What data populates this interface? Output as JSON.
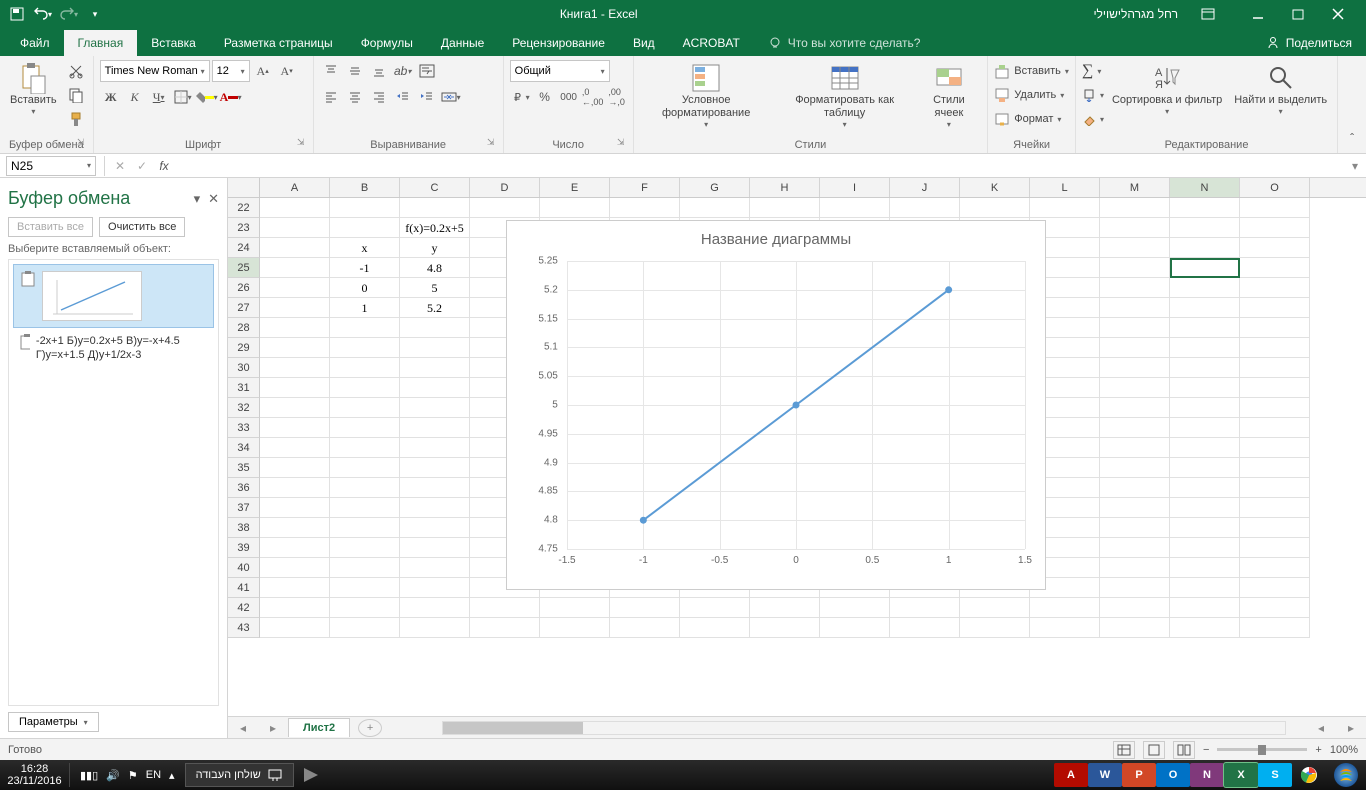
{
  "title": "Книга1  -  Excel",
  "user": "רחל מגרהלישוילי",
  "tabs": {
    "file": "Файл",
    "home": "Главная",
    "insert": "Вставка",
    "layout": "Разметка страницы",
    "formulas": "Формулы",
    "data": "Данные",
    "review": "Рецензирование",
    "view": "Вид",
    "acrobat": "ACROBAT",
    "tell": "Что вы хотите сделать?",
    "share": "Поделиться"
  },
  "ribbon": {
    "clipboard": {
      "label": "Буфер обмена",
      "paste": "Вставить"
    },
    "font": {
      "label": "Шрифт",
      "name": "Times New Roman",
      "size": "12"
    },
    "align": {
      "label": "Выравнивание"
    },
    "number": {
      "label": "Число",
      "format": "Общий"
    },
    "styles": {
      "label": "Стили",
      "cond": "Условное форматирование",
      "table": "Форматировать как таблицу",
      "cell": "Стили ячеек"
    },
    "cells": {
      "label": "Ячейки",
      "insert": "Вставить",
      "delete": "Удалить",
      "format": "Формат"
    },
    "edit": {
      "label": "Редактирование",
      "sort": "Сортировка и фильтр",
      "find": "Найти и выделить"
    }
  },
  "namebox": "N25",
  "formula": "",
  "clipboard_pane": {
    "title": "Буфер обмена",
    "paste_all": "Вставить все",
    "clear_all": "Очистить все",
    "subtitle": "Выберите вставляемый объект:",
    "item_text": "-2x+1 Б)y=0.2x+5 В)y=-x+4.5 Г)y=x+1.5 Д)y+1/2x-3",
    "params": "Параметры"
  },
  "columns": [
    "A",
    "B",
    "C",
    "D",
    "E",
    "F",
    "G",
    "H",
    "I",
    "J",
    "K",
    "L",
    "M",
    "N",
    "O"
  ],
  "rows_start": 22,
  "rows_end": 43,
  "active_cell": {
    "col": "N",
    "row": 25
  },
  "cells": {
    "C23": "f(x)=0.2x+5",
    "B24": "x",
    "C24": "y",
    "B25": "-1",
    "C25": "4.8",
    "B26": "0",
    "C26": "5",
    "B27": "1",
    "C27": "5.2"
  },
  "chart_data": {
    "type": "line",
    "title": "Название диаграммы",
    "x": [
      -1,
      0,
      1
    ],
    "y": [
      4.8,
      5,
      5.2
    ],
    "xlim": [
      -1.5,
      1.5
    ],
    "ylim": [
      4.75,
      5.25
    ],
    "xticks": [
      -1.5,
      -1,
      -0.5,
      0,
      0.5,
      1,
      1.5
    ],
    "yticks": [
      4.75,
      4.8,
      4.85,
      4.9,
      4.95,
      5,
      5.05,
      5.1,
      5.15,
      5.2,
      5.25
    ]
  },
  "sheet": "Лист2",
  "status": "Готово",
  "zoom": "100%",
  "taskbar": {
    "time": "16:28",
    "date": "23/11/2016",
    "lang": "EN",
    "desktop": "שולחן העבודה"
  }
}
